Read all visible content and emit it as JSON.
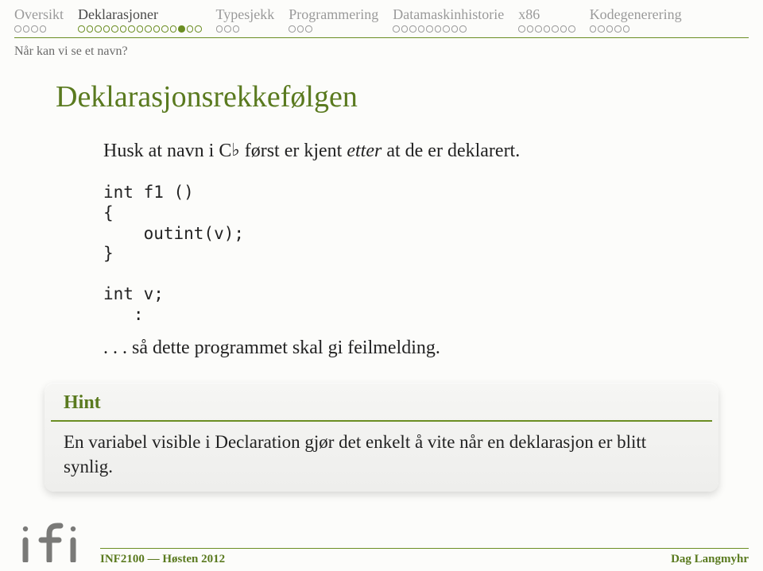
{
  "nav": {
    "items": [
      {
        "label": "Oversikt",
        "dots": 4,
        "active": false,
        "current": -1
      },
      {
        "label": "Deklarasjoner",
        "dots": 15,
        "active": true,
        "current": 12
      },
      {
        "label": "Typesjekk",
        "dots": 3,
        "active": false,
        "current": -1
      },
      {
        "label": "Programmering",
        "dots": 3,
        "active": false,
        "current": -1
      },
      {
        "label": "Datamaskinhistorie",
        "dots": 9,
        "active": false,
        "current": -1
      },
      {
        "label": "x86",
        "dots": 7,
        "active": false,
        "current": -1
      },
      {
        "label": "Kodegenerering",
        "dots": 5,
        "active": false,
        "current": -1
      }
    ]
  },
  "subtitle": "Når kan vi se et navn?",
  "title": "Deklarasjonsrekkefølgen",
  "intro_pre": "Husk at navn i C",
  "intro_flat": "♭",
  "intro_mid": " først er kjent ",
  "intro_em": "etter",
  "intro_post": " at de er deklarert.",
  "code": "int f1 ()\n{\n    outint(v);\n}\n\nint v;\n   :",
  "outro": ". . . så dette programmet skal gi feilmelding.",
  "hint": {
    "title": "Hint",
    "text": "En variabel visible i Declaration gjør det enkelt å vite når en deklarasjon er blitt synlig."
  },
  "footer": {
    "left": "INF2100 — Høsten 2012",
    "right": "Dag Langmyhr"
  }
}
